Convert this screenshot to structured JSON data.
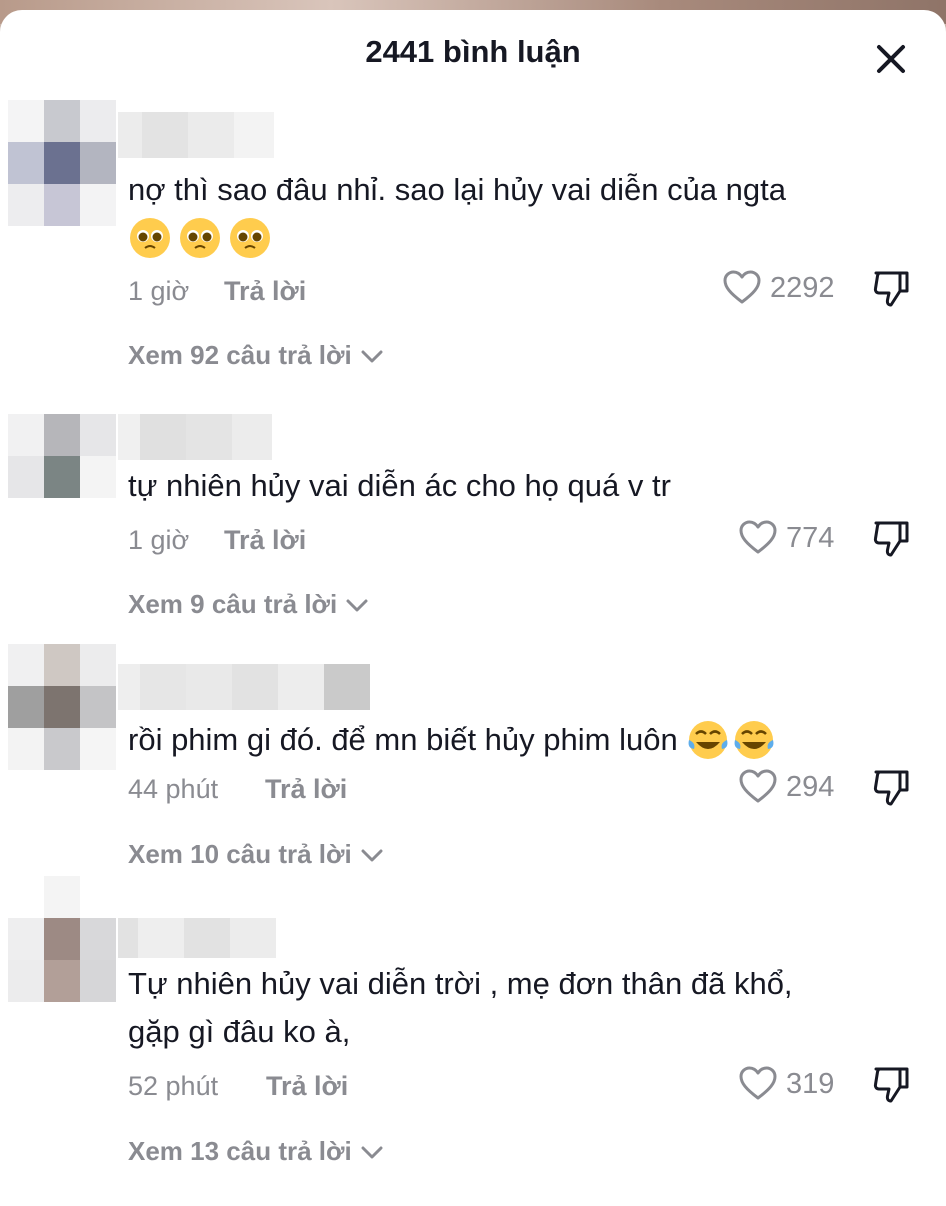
{
  "header": {
    "title": "2441 bình luận"
  },
  "icons": {
    "close": "close-icon",
    "like": "heart-outline-icon",
    "dislike": "thumbs-down-icon",
    "expand": "chevron-down-icon",
    "emoji_pleading": "pleading-face-emoji",
    "emoji_joy": "face-with-tears-of-joy-emoji"
  },
  "colors": {
    "text": "#161823",
    "muted": "#8a8b91",
    "background": "#ffffff"
  },
  "comments": [
    {
      "text_line1": "nợ thì sao đâu nhỉ. sao lại hủy vai diễn của ngta",
      "emojis": [
        "🥺",
        "🥺",
        "🥺"
      ],
      "time": "1 giờ",
      "reply_label": "Trả lời",
      "likes": "2292",
      "view_replies": "Xem 92 câu trả lời"
    },
    {
      "text_line1": "tự nhiên hủy vai diễn ác cho họ quá v tr",
      "time": "1 giờ",
      "reply_label": "Trả lời",
      "likes": "774",
      "view_replies": "Xem 9 câu trả lời"
    },
    {
      "text_line1": "rồi phim gi đó. để mn biết hủy phim luôn",
      "emojis": [
        "😂",
        "😂"
      ],
      "time": "44 phút",
      "reply_label": "Trả lời",
      "likes": "294",
      "view_replies": "Xem 10 câu trả lời"
    },
    {
      "text_line1": "Tự nhiên hủy vai diễn trời , mẹ đơn thân đã khổ,",
      "text_line2": "gặp gì đâu ko à,",
      "time": "52 phút",
      "reply_label": "Trả lời",
      "likes": "319",
      "view_replies": "Xem 13 câu trả lời"
    }
  ]
}
